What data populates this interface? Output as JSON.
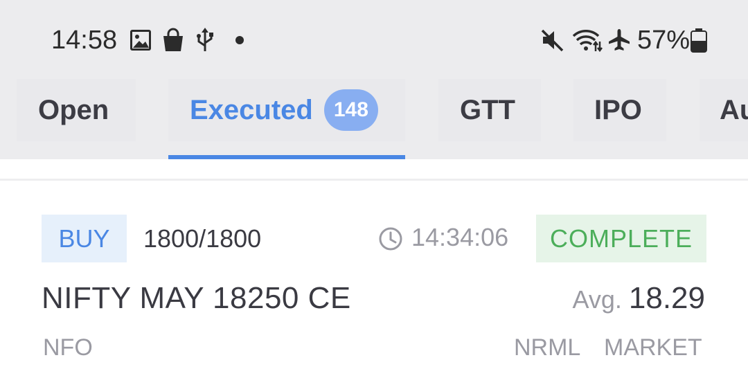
{
  "status_bar": {
    "time": "14:58",
    "battery": "57%",
    "icons": [
      "gallery-icon",
      "shopping-bag-icon",
      "usb-icon",
      "notification-dot",
      "mute-icon",
      "wifi-icon",
      "airplane-icon",
      "battery-icon"
    ]
  },
  "tabs": [
    {
      "label": "Open"
    },
    {
      "label": "Executed",
      "badge": "148",
      "active": true
    },
    {
      "label": "GTT"
    },
    {
      "label": "IPO"
    },
    {
      "label": "Au"
    }
  ],
  "order": {
    "side": "BUY",
    "quantity": "1800/1800",
    "time": "14:34:06",
    "status": "COMPLETE",
    "instrument": "NIFTY MAY 18250 CE",
    "avg_label": "Avg.",
    "avg_price": "18.29",
    "exchange": "NFO",
    "product": "NRML",
    "order_type": "MARKET"
  },
  "colors": {
    "accent": "#4a87e4",
    "badge": "#88aef1",
    "complete": "#4cae5a",
    "complete_bg": "#e6f4e8",
    "buy_bg": "#e6f0fb",
    "muted_text": "#9a9aa2"
  }
}
